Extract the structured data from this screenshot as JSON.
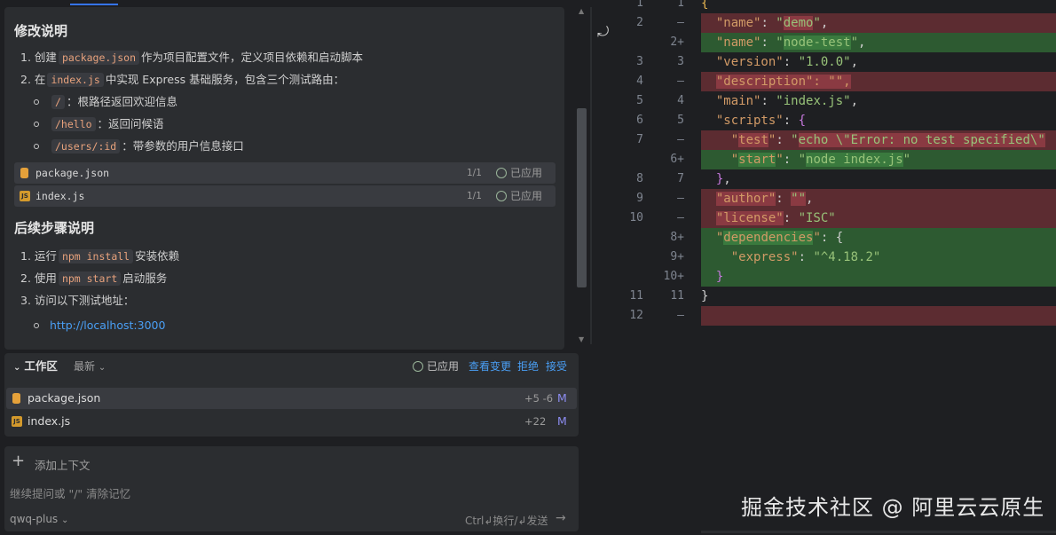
{
  "chat": {
    "section1_title": "修改说明",
    "items1": [
      {
        "num": "1.",
        "pre": "创建",
        "code": "package.json",
        "post": "作为项目配置文件，定义项目依赖和启动脚本"
      },
      {
        "num": "2.",
        "pre": "在",
        "code": "index.js",
        "post": "中实现 Express 基础服务，包含三个测试路由："
      }
    ],
    "routes": [
      {
        "code": "/",
        "desc": "：根路径返回欢迎信息"
      },
      {
        "code": "/hello",
        "desc": "：返回问候语"
      },
      {
        "code": "/users/:id",
        "desc": "：带参数的用户信息接口"
      }
    ],
    "files": [
      {
        "name": "package.json",
        "count": "1/1",
        "status": "已应用"
      },
      {
        "name": "index.js",
        "count": "1/1",
        "status": "已应用"
      }
    ],
    "section2_title": "后续步骤说明",
    "steps": [
      {
        "num": "1.",
        "pre": "运行",
        "code": "npm install",
        "post": "安装依赖"
      },
      {
        "num": "2.",
        "pre": "使用",
        "code": "npm start",
        "post": "启动服务"
      },
      {
        "num": "3.",
        "pre": "访问以下测试地址：",
        "code": "",
        "post": ""
      }
    ],
    "url": "http://localhost:3000"
  },
  "workspace": {
    "title": "工作区",
    "sort": "最新",
    "applied": "已应用",
    "view_changes": "查看变更",
    "reject": "拒绝",
    "accept": "接受",
    "files": [
      {
        "name": "package.json",
        "diff": "+5 -6",
        "mark": "M"
      },
      {
        "name": "index.js",
        "diff": "+22",
        "mark": "M"
      }
    ]
  },
  "input": {
    "add_context": "添加上下文",
    "placeholder": "继续提问或 \"/\" 清除记忆",
    "model": "qwq-plus",
    "send_hint": "Ctrl↲换行/↲发送"
  },
  "diff": {
    "lines": [
      {
        "l": "1",
        "r": "1",
        "type": "ctx",
        "text": "{"
      },
      {
        "l": "2",
        "r": "—",
        "type": "del",
        "text": "\"name\": \"demo\","
      },
      {
        "l": "",
        "r": "2+",
        "type": "add",
        "text": "\"name\": \"node-test\","
      },
      {
        "l": "3",
        "r": "3",
        "type": "ctx",
        "text": "\"version\": \"1.0.0\","
      },
      {
        "l": "4",
        "r": "—",
        "type": "del",
        "text": "\"description\": \"\","
      },
      {
        "l": "5",
        "r": "4",
        "type": "ctx",
        "text": "\"main\": \"index.js\","
      },
      {
        "l": "6",
        "r": "5",
        "type": "ctx",
        "text": "\"scripts\": {"
      },
      {
        "l": "7",
        "r": "—",
        "type": "del",
        "text": "  \"test\": \"echo \\\"Error: no test specified\\\""
      },
      {
        "l": "",
        "r": "6+",
        "type": "add",
        "text": "  \"start\": \"node index.js\""
      },
      {
        "l": "8",
        "r": "7",
        "type": "ctx",
        "text": "},"
      },
      {
        "l": "9",
        "r": "—",
        "type": "del",
        "text": "\"author\": \"\","
      },
      {
        "l": "10",
        "r": "—",
        "type": "del",
        "text": "\"license\": \"ISC\""
      },
      {
        "l": "",
        "r": "8+",
        "type": "add",
        "text": "\"dependencies\": {"
      },
      {
        "l": "",
        "r": "9+",
        "type": "add",
        "text": "  \"express\": \"^4.18.2\""
      },
      {
        "l": "",
        "r": "10+",
        "type": "add",
        "text": "}"
      },
      {
        "l": "11",
        "r": "11",
        "type": "ctx",
        "text": "}"
      },
      {
        "l": "12",
        "r": "—",
        "type": "del",
        "text": ""
      }
    ]
  },
  "watermark": "掘金技术社区 @ 阿里云云原生"
}
